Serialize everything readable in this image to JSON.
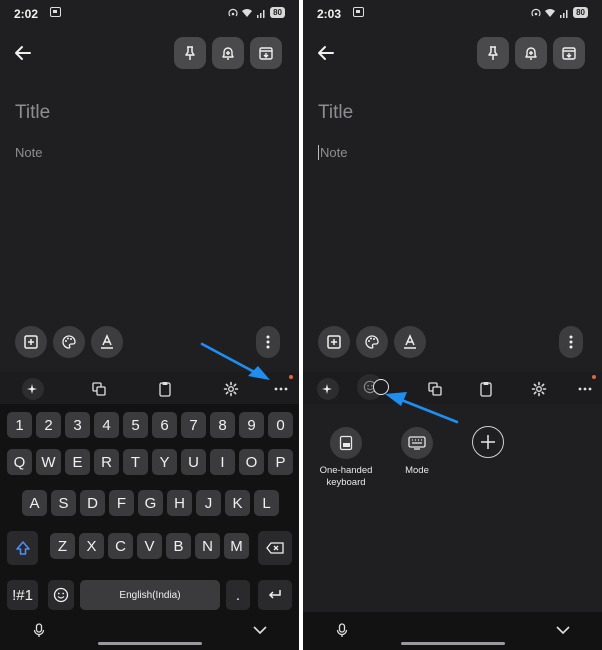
{
  "screens": [
    {
      "time": "2:02",
      "battery": "80",
      "title_placeholder": "Title",
      "note_placeholder": "Note",
      "keyboard": {
        "number_row": [
          "1",
          "2",
          "3",
          "4",
          "5",
          "6",
          "7",
          "8",
          "9",
          "0"
        ],
        "row1": [
          "Q",
          "W",
          "E",
          "R",
          "T",
          "Y",
          "U",
          "I",
          "O",
          "P"
        ],
        "row2": [
          "A",
          "S",
          "D",
          "F",
          "G",
          "H",
          "J",
          "K",
          "L"
        ],
        "row3": [
          "Z",
          "X",
          "C",
          "V",
          "B",
          "N",
          "M"
        ],
        "symbols_key": "!#1",
        "space_label": "English(India)",
        "period": "."
      }
    },
    {
      "time": "2:03",
      "battery": "80",
      "title_placeholder": "Title",
      "note_placeholder": "Note",
      "panel": {
        "items": [
          {
            "label": "One-handed keyboard",
            "icon": "one-handed-keyboard-icon"
          },
          {
            "label": "Mode",
            "icon": "keyboard-mode-icon"
          }
        ],
        "add_icon": "plus-icon"
      }
    }
  ],
  "colors": {
    "background": "#1f1f21",
    "keyboard": "#121213",
    "key": "#3b3b3e",
    "annotation_arrow": "#1e8ff0",
    "notification_dot": "#e0663a",
    "shift_active": "#4f8ff7"
  }
}
